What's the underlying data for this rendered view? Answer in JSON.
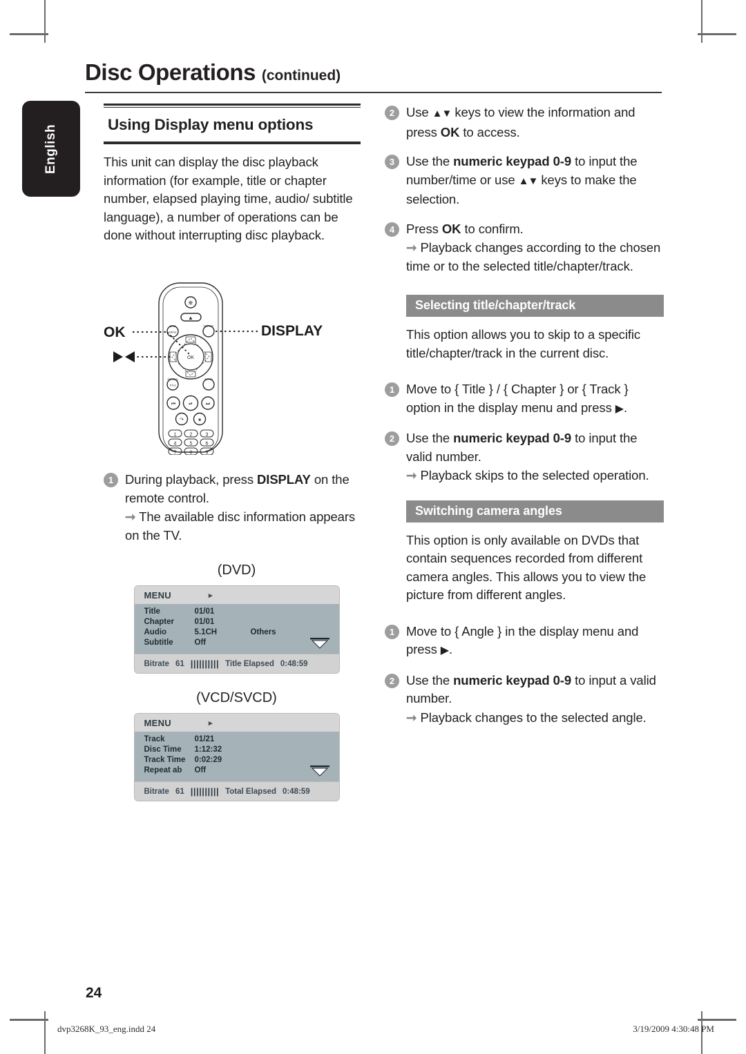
{
  "page": {
    "title_main": "Disc Operations",
    "title_continued": "(continued)",
    "language_tab": "English",
    "page_number": "24"
  },
  "footer": {
    "file": "dvp3268K_93_eng.indd   24",
    "timestamp": "3/19/2009   4:30:48 PM"
  },
  "left_column": {
    "section_title": "Using Display menu options",
    "intro": "This unit can display the disc playback information (for example, title or chapter number, elapsed playing time, audio/ subtitle language), a number of operations can be done without interrupting disc playback.",
    "remote": {
      "callout_ok": "OK",
      "callout_navigation": "navigation-arrows",
      "callout_display": "DISPLAY",
      "buttons": {
        "power": "standby-power",
        "eject": "open-close",
        "disc_menu": "DISC MENU",
        "display": "DISPLAY",
        "ok": "OK",
        "return_title": "RETURN/TITLE",
        "setup": "SETUP",
        "prev": "previous",
        "play_pause": "play-pause",
        "next": "next",
        "audio": "audio",
        "stop": "stop",
        "keys": [
          "1",
          "2",
          "3",
          "4",
          "5",
          "6",
          "7",
          "8",
          "9"
        ]
      }
    },
    "step1": {
      "number": "1",
      "text_a": "During playback, press ",
      "text_b": "DISPLAY",
      "text_c": " on the remote control.",
      "result": "The available disc information appears on the TV."
    },
    "dvd_caption": "(DVD)",
    "vcd_caption": "(VCD/SVCD)"
  },
  "osd_dvd": {
    "header": "MENU",
    "caret": "▸",
    "rows": [
      {
        "key": "Title",
        "value": "01/01",
        "extra": ""
      },
      {
        "key": "Chapter",
        "value": "01/01",
        "extra": ""
      },
      {
        "key": "Audio",
        "value": "5.1CH",
        "extra": "Others"
      },
      {
        "key": "Subtitle",
        "value": "Off",
        "extra": ""
      }
    ],
    "footer": {
      "bitrate_label": "Bitrate",
      "bitrate_value": "61",
      "bitrate_bars": "||||||||||",
      "elapsed_label": "Title Elapsed",
      "elapsed_value": "0:48:59"
    }
  },
  "osd_vcd": {
    "header": "MENU",
    "caret": "▸",
    "rows": [
      {
        "key": "Track",
        "value": "01/21",
        "extra": ""
      },
      {
        "key": "Disc  Time",
        "value": "1:12:32",
        "extra": ""
      },
      {
        "key": "Track  Time",
        "value": "0:02:29",
        "extra": ""
      },
      {
        "key": "Repeat  ab",
        "value": "Off",
        "extra": ""
      }
    ],
    "footer": {
      "bitrate_label": "Bitrate",
      "bitrate_value": "61",
      "bitrate_bars": "||||||||||",
      "elapsed_label": "Total Elapsed",
      "elapsed_value": "0:48:59"
    }
  },
  "right_column": {
    "step2": {
      "number": "2",
      "a": "Use ",
      "arrows": "▲▼",
      "b": " keys to view the information and press ",
      "ok": "OK",
      "c": " to access."
    },
    "step3": {
      "number": "3",
      "a": "Use the ",
      "bold": "numeric keypad 0-9",
      "b": " to input the number/time or use ",
      "arrows": "▲▼",
      "c": " keys to make the selection."
    },
    "step4": {
      "number": "4",
      "a": "Press ",
      "ok": "OK",
      "b": " to confirm.",
      "result": "Playback changes according to the chosen time or to the selected title/chapter/track."
    },
    "section_title_chapter": {
      "banner": "Selecting title/chapter/track",
      "intro": "This option allows you to skip to a specific title/chapter/track in the current disc.",
      "step1": {
        "number": "1",
        "a": "Move to { Title } / { Chapter } or { Track } option in the display menu and press ",
        "arrow": "▶",
        "b": "."
      },
      "step2": {
        "number": "2",
        "a": "Use the ",
        "bold": "numeric keypad 0-9",
        "b": " to input the valid number.",
        "result": "Playback skips to the selected operation."
      }
    },
    "section_camera_angles": {
      "banner": "Switching camera angles",
      "intro": "This option is only available on DVDs that contain sequences recorded from different camera angles. This allows you to view the picture from different angles.",
      "step1": {
        "number": "1",
        "a": "Move to { Angle } in the display menu and press ",
        "arrow": "▶",
        "b": "."
      },
      "step2": {
        "number": "2",
        "a": "Use the ",
        "bold": "numeric keypad 0-9",
        "b": " to input a valid number.",
        "result": "Playback changes to the selected angle."
      }
    }
  },
  "colors": {
    "ink": "#231f20",
    "banner_gray": "#8b8b8b",
    "step_bullet": "#9d9d9d",
    "osd_body": "#a5b2b8",
    "osd_header": "#d6d6d6",
    "osd_footer": "#d2d2d2"
  }
}
